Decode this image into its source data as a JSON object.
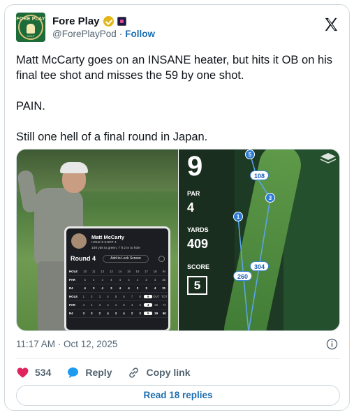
{
  "post": {
    "author_name": "Fore Play",
    "handle": "@ForePlayPod",
    "separator": "·",
    "follow_label": "Follow",
    "avatar_text": "FORE PLAY",
    "avatar_sub": "GOLF",
    "text_lines": [
      "Matt McCarty goes on an INSANE heater, but hits it OB on his final tee shot and misses the 59 by one shot.",
      "PAIN.",
      "Still one hell of a final round in Japan."
    ],
    "timestamp": "11:17 AM · Oct 12, 2025"
  },
  "scorecard": {
    "player": "Matt McCarty",
    "hole_shot": "HOLE 9  SHOT 4",
    "distance": "108 yds to green, 7 ft 2 in to hole",
    "round_label": "Round 4",
    "lock_label": "Add to Lock Screen",
    "back_rows": [
      [
        "HOLE",
        "10",
        "11",
        "12",
        "13",
        "14",
        "15",
        "16",
        "17",
        "18",
        "IN"
      ],
      [
        "PAR",
        "4",
        "4",
        "4",
        "4",
        "4",
        "4",
        "4",
        "3",
        "4",
        "35"
      ],
      [
        "R4",
        "4",
        "3",
        "4",
        "3",
        "4",
        "4",
        "2",
        "3",
        "4",
        "31"
      ]
    ],
    "front_rows": [
      [
        "HOLE",
        "1",
        "2",
        "3",
        "4",
        "5",
        "6",
        "7",
        "8",
        "9",
        "OUT",
        "TOT"
      ],
      [
        "PAR",
        "4",
        "4",
        "3",
        "4",
        "4",
        "5",
        "4",
        "3",
        "4",
        "36",
        "71"
      ],
      [
        "R4",
        "3",
        "3",
        "2",
        "4",
        "3",
        "4",
        "2",
        "3",
        "5",
        "29",
        "60"
      ]
    ]
  },
  "hole_map": {
    "hole_number": "9",
    "par_label": "PAR",
    "par_value": "4",
    "yards_label": "YARDS",
    "yards_value": "409",
    "score_label": "SCORE",
    "score_value": "5",
    "markers": {
      "shot5": "5",
      "shot3": "3",
      "shot1": "1",
      "d108": "108",
      "d304": "304",
      "d260": "260"
    }
  },
  "engagement": {
    "likes": "534",
    "reply_label": "Reply",
    "copy_label": "Copy link",
    "read_replies": "Read 18 replies"
  },
  "colors": {
    "link": "#1d6fb0",
    "like": "#e0245e",
    "reply": "#1d9bf0",
    "verified": "#e2b719"
  }
}
